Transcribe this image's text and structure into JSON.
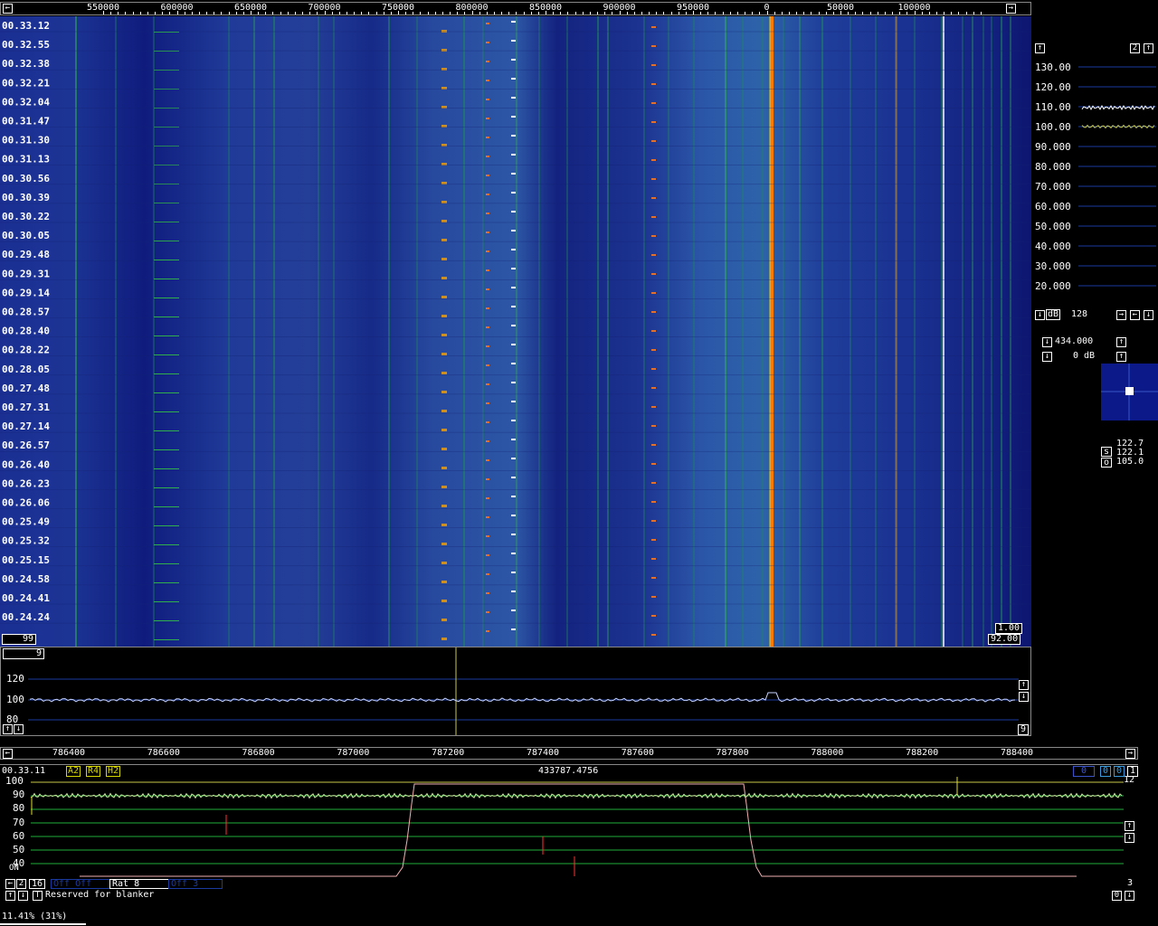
{
  "waterfall": {
    "freq_ticks": [
      "550000",
      "600000",
      "650000",
      "700000",
      "750000",
      "800000",
      "850000",
      "900000",
      "950000",
      "0",
      "50000",
      "100000"
    ],
    "time_labels": [
      "00.33.12",
      "00.32.55",
      "00.32.38",
      "00.32.21",
      "00.32.04",
      "00.31.47",
      "00.31.30",
      "00.31.13",
      "00.30.56",
      "00.30.39",
      "00.30.22",
      "00.30.05",
      "00.29.48",
      "00.29.31",
      "00.29.14",
      "00.28.57",
      "00.28.40",
      "00.28.22",
      "00.28.05",
      "00.27.48",
      "00.27.31",
      "00.27.14",
      "00.26.57",
      "00.26.40",
      "00.26.23",
      "00.26.06",
      "00.25.49",
      "00.25.32",
      "00.25.15",
      "00.24.58",
      "00.24.41",
      "00.24.24"
    ],
    "bottom_left_value": "99",
    "right_value_top": "1.00",
    "right_value_bottom": "92.00",
    "arrow_left": "←",
    "arrow_right": "→"
  },
  "spectrum": {
    "top_value": "9",
    "bottom_value": "9",
    "y_labels": [
      "120",
      "100",
      "80"
    ],
    "up": "↑",
    "down": "↓"
  },
  "side_panel": {
    "count": "2",
    "up": "↑",
    "down": "↓",
    "left": "←",
    "right": "→",
    "levels": [
      "130.00",
      "120.00",
      "110.00",
      "100.00",
      "90.000",
      "80.000",
      "70.000",
      "60.000",
      "50.000",
      "40.000",
      "30.000",
      "20.000"
    ],
    "db_label": "dB",
    "db_value": "128",
    "freq_value": "434.000",
    "gain_value": "0 dB",
    "meter_s_label": "s",
    "meter_s1": "122.7",
    "meter_s2": "122.1",
    "meter_o_label": "o",
    "meter_o": "105.0"
  },
  "baseband": {
    "freq_ticks": [
      "786400",
      "786600",
      "786800",
      "787000",
      "787200",
      "787400",
      "787600",
      "787800",
      "788000",
      "788200",
      "788400"
    ],
    "time": "00.33.11",
    "mode_a": "A2",
    "mode_r": "R4",
    "mode_h": "H2",
    "center_freq": "433787.4756",
    "right_boxes": [
      "0",
      "0",
      "0"
    ],
    "right_num": "1",
    "right_top_num": "12",
    "y_labels": [
      "100",
      "90",
      "80",
      "70",
      "60",
      "50",
      "40"
    ],
    "on_label": "ON",
    "b_count": "2",
    "b_bw": "16",
    "b_field1": "Off Off",
    "b_rat": "Rat 8",
    "b_field3": "Off 3",
    "b_t": "T",
    "status_msg": "Reserved for blanker",
    "right_bottom": "3",
    "right_bottom_box": "0"
  },
  "footer": {
    "cpu": "11.41% (31%)"
  },
  "colors": {
    "waterfall_bg": "#1c2d8c",
    "carrier_orange": "#ff7a00",
    "green_trace": "#22c040",
    "grid_blue": "#1a3aa0"
  }
}
